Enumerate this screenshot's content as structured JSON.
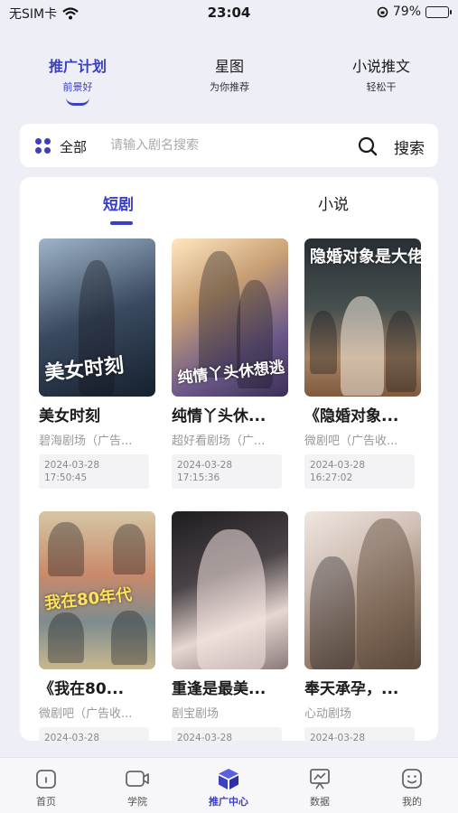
{
  "status": {
    "carrier": "无SIM卡",
    "time": "23:04",
    "battery": "79%",
    "battery_level": 0.79
  },
  "top_tabs": [
    {
      "title": "推广计划",
      "subtitle": "前景好",
      "active": true
    },
    {
      "title": "星图",
      "subtitle": "为你推荐",
      "active": false
    },
    {
      "title": "小说推文",
      "subtitle": "轻松干",
      "active": false
    }
  ],
  "search": {
    "category": "全部",
    "placeholder": "请输入剧名搜索",
    "button": "搜索"
  },
  "content_tabs": [
    {
      "label": "短剧",
      "active": true
    },
    {
      "label": "小说",
      "active": false
    }
  ],
  "items": [
    {
      "title": "美女时刻",
      "source": "碧海剧场（广告...",
      "date": "2024-03-28",
      "time": "17:50:45",
      "poster_text": "美女时刻"
    },
    {
      "title": "纯情丫头休...",
      "source": "超好看剧场（广...",
      "date": "2024-03-28",
      "time": "17:15:36",
      "poster_text": "纯情丫头休想逃"
    },
    {
      "title": "《隐婚对象...",
      "source": "微剧吧（广告收...",
      "date": "2024-03-28",
      "time": "16:27:02",
      "poster_text": "隐婚对象是大佬"
    },
    {
      "title": "《我在80...",
      "source": "微剧吧（广告收...",
      "date": "2024-03-28",
      "time": "",
      "poster_text": "我在80年代"
    },
    {
      "title": "重逢是最美...",
      "source": "剧宝剧场",
      "date": "2024-03-28",
      "time": "",
      "poster_text": ""
    },
    {
      "title": "奉天承孕，...",
      "source": "心动剧场",
      "date": "2024-03-28",
      "time": "",
      "poster_text": ""
    }
  ],
  "bottom_tabs": [
    {
      "label": "首页",
      "icon": "home-icon",
      "active": false
    },
    {
      "label": "学院",
      "icon": "video-icon",
      "active": false
    },
    {
      "label": "推广中心",
      "icon": "cube-icon",
      "active": true
    },
    {
      "label": "数据",
      "icon": "chart-board-icon",
      "active": false
    },
    {
      "label": "我的",
      "icon": "face-icon",
      "active": false
    }
  ],
  "colors": {
    "accent": "#3a3fc4",
    "background": "#eeeef7"
  }
}
